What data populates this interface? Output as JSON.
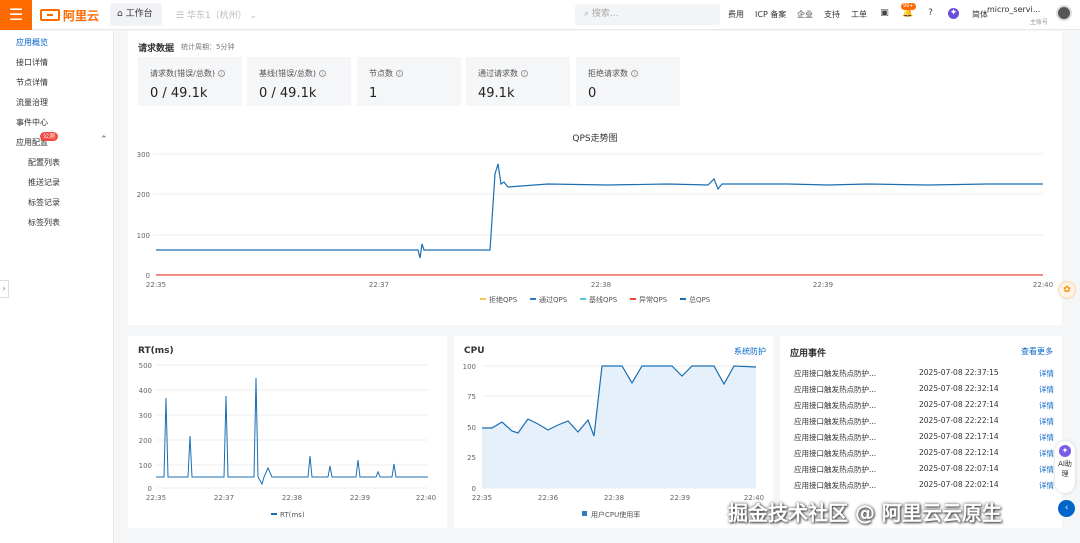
{
  "topbar": {
    "menu_icon": "hamburger-icon",
    "brand": "阿里云",
    "workbench": "工作台",
    "region": "华东1（杭州）",
    "search_placeholder": "搜索...",
    "nav": [
      "费用",
      "ICP 备案",
      "企业",
      "支持",
      "工单"
    ],
    "notify_badge": "99+",
    "lang": "简体",
    "account_name": "micro_servi...",
    "account_sub": "主账号"
  },
  "sidebar": {
    "items": [
      "应用概览",
      "接口详情",
      "节点详情",
      "流量治理",
      "事件中心",
      "应用配置"
    ],
    "sub_items": [
      "配置列表",
      "推送记录",
      "标签记录",
      "标签列表"
    ],
    "new_badge": "公测"
  },
  "overview": {
    "title": "请求数据",
    "period": "统计周期：5分钟",
    "cards": [
      {
        "label": "请求数(错误/总数)",
        "value": "0 / 49.1k"
      },
      {
        "label": "基线(错误/总数)",
        "value": "0 / 49.1k"
      },
      {
        "label": "节点数",
        "value": "1"
      },
      {
        "label": "通过请求数",
        "value": "49.1k"
      },
      {
        "label": "拒绝请求数",
        "value": "0"
      }
    ]
  },
  "colors": {
    "accent": "#ff6a00",
    "link": "#0064c8",
    "line": "#1a6fb3",
    "pass": "#2d7dc6",
    "reject": "#f2c94c",
    "anomaly": "#e84a3b",
    "baseline": "#59c8d8"
  },
  "qps_chart": {
    "title": "QPS走势图",
    "y_ticks": [
      "300",
      "200",
      "100",
      "0"
    ],
    "x_ticks": [
      "22:35",
      "22:37",
      "22:38",
      "22:39",
      "22:40"
    ],
    "legend": [
      "拒绝QPS",
      "通过QPS",
      "基线QPS",
      "异常QPS",
      "总QPS"
    ]
  },
  "rt_chart": {
    "title": "RT(ms)",
    "y_ticks": [
      "500",
      "400",
      "300",
      "200",
      "100",
      "0"
    ],
    "x_ticks": [
      "22:35",
      "22:37",
      "22:38",
      "22:39",
      "22:40"
    ],
    "legend": "RT(ms)"
  },
  "cpu_chart": {
    "title": "CPU",
    "link": "系统防护",
    "y_ticks": [
      "100",
      "75",
      "50",
      "25",
      "0"
    ],
    "x_ticks": [
      "22:35",
      "22:36",
      "22:38",
      "22:39",
      "22:40"
    ],
    "legend": "用户CPU使用率"
  },
  "chart_data": [
    {
      "type": "line",
      "title": "QPS走势图",
      "x": [
        "22:35",
        "22:36",
        "22:37",
        "22:37.5",
        "22:38",
        "22:39",
        "22:40"
      ],
      "series": [
        {
          "name": "总QPS",
          "values": [
            62,
            62,
            62,
            62,
            218,
            222,
            222
          ]
        },
        {
          "name": "异常QPS",
          "values": [
            0,
            0,
            0,
            0,
            0,
            0,
            0
          ]
        }
      ],
      "ylim": [
        0,
        300
      ]
    },
    {
      "type": "line",
      "title": "RT(ms)",
      "x": [
        "22:35",
        "22:37",
        "22:38",
        "22:39",
        "22:40"
      ],
      "series": [
        {
          "name": "RT(ms)",
          "values": [
            45,
            45,
            45,
            45,
            45
          ]
        }
      ],
      "ylim": [
        0,
        500
      ]
    },
    {
      "type": "area",
      "title": "CPU",
      "x": [
        "22:35",
        "22:36",
        "22:37",
        "22:38",
        "22:39",
        "22:40"
      ],
      "series": [
        {
          "name": "用户CPU使用率",
          "values": [
            50,
            52,
            52,
            100,
            95,
            100
          ]
        }
      ],
      "ylim": [
        0,
        100
      ]
    }
  ],
  "events": {
    "title": "应用事件",
    "more": "查看更多",
    "rows": [
      {
        "name": "应用接口触发热点防护...",
        "time": "2025-07-08 22:37:15",
        "action": "详情"
      },
      {
        "name": "应用接口触发热点防护...",
        "time": "2025-07-08 22:32:14",
        "action": "详情"
      },
      {
        "name": "应用接口触发热点防护...",
        "time": "2025-07-08 22:27:14",
        "action": "详情"
      },
      {
        "name": "应用接口触发热点防护...",
        "time": "2025-07-08 22:22:14",
        "action": "详情"
      },
      {
        "name": "应用接口触发热点防护...",
        "time": "2025-07-08 22:17:14",
        "action": "详情"
      },
      {
        "name": "应用接口触发热点防护...",
        "time": "2025-07-08 22:12:14",
        "action": "详情"
      },
      {
        "name": "应用接口触发热点防护...",
        "time": "2025-07-08 22:07:14",
        "action": "详情"
      },
      {
        "name": "应用接口触发热点防护...",
        "time": "2025-07-08 22:02:14",
        "action": "详情"
      }
    ]
  },
  "ai": {
    "label": "AI助理"
  },
  "watermark": "掘金技术社区 @ 阿里云云原生"
}
